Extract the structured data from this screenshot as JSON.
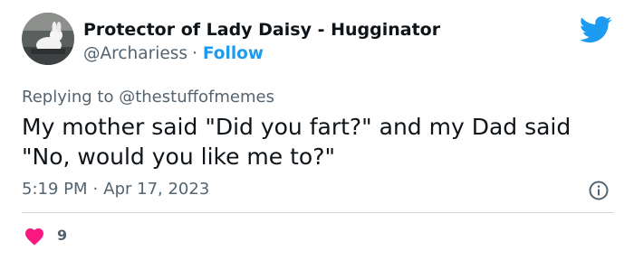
{
  "author": {
    "display_name": "Protector of Lady Daisy - Hugginator",
    "handle": "@Archariess",
    "separator": "·",
    "follow_label": "Follow"
  },
  "reply": {
    "prefix": "Replying to",
    "mention": "@thestuffofmemes"
  },
  "tweet": {
    "text": "My mother said \"Did you fart?\" and my Dad said \"No, would you like me to?\""
  },
  "meta": {
    "time": "5:19 PM",
    "separator": "·",
    "date": "Apr 17, 2023"
  },
  "stats": {
    "likes": "9"
  },
  "icons": {
    "brand": "twitter-bird-icon",
    "info": "info-icon",
    "like": "heart-icon"
  },
  "colors": {
    "brand_blue": "#1d9bf0",
    "like_red": "#f91880",
    "secondary_text": "#536471",
    "primary_text": "#0f1419",
    "divider": "#cfd9de"
  }
}
